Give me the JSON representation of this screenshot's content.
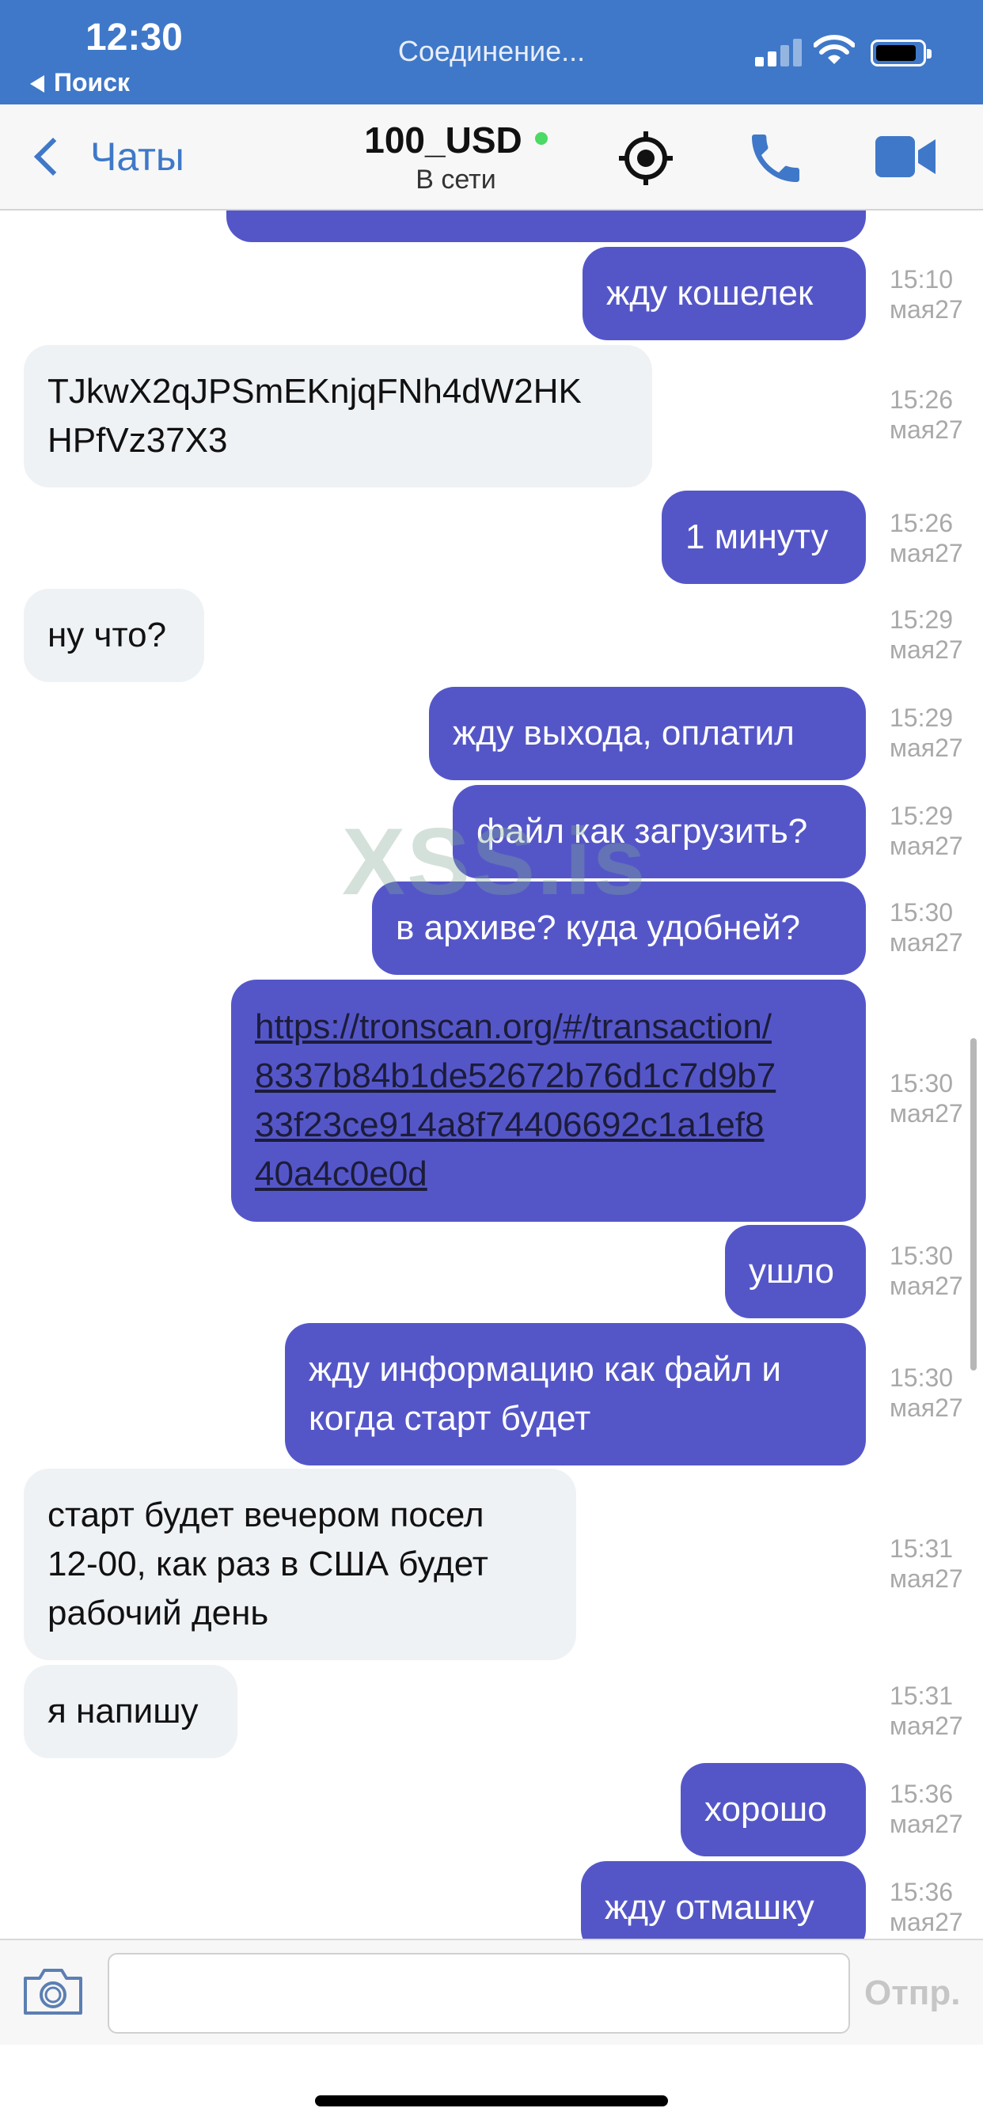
{
  "status_bar": {
    "time": "12:30",
    "back_app": "Поиск",
    "connection": "Соединение..."
  },
  "nav": {
    "back_label": "Чаты",
    "contact_name": "100_USD",
    "contact_status": "В сети",
    "online_color": "#4cd964",
    "accent_color": "#3f78c8"
  },
  "colors": {
    "outgoing_bubble": "#5456c8",
    "incoming_bubble": "#eff2f5"
  },
  "messages": [
    {
      "direction": "out",
      "text": "жду кошелек",
      "time": "15:10",
      "date": "мая27"
    },
    {
      "direction": "in",
      "lines": [
        "TJkwX2qJPSmEKnjqFNh4dW2HK",
        "HPfVz37X3"
      ],
      "time": "15:26",
      "date": "мая27"
    },
    {
      "direction": "out",
      "text": "1 минуту",
      "time": "15:26",
      "date": "мая27"
    },
    {
      "direction": "in",
      "text": "ну что?",
      "time": "15:29",
      "date": "мая27"
    },
    {
      "direction": "out",
      "text": "жду выхода, оплатил",
      "time": "15:29",
      "date": "мая27"
    },
    {
      "direction": "out",
      "text": "файл как загрузить?",
      "time": "15:29",
      "date": "мая27"
    },
    {
      "direction": "out",
      "text": "в архиве? куда удобней?",
      "time": "15:30",
      "date": "мая27"
    },
    {
      "direction": "out",
      "lines": [
        "https://tronscan.org/#/transaction/",
        "8337b84b1de52672b76d1c7d9b7",
        "33f23ce914a8f74406692c1a1ef8",
        "40a4c0e0d"
      ],
      "time": "15:30",
      "date": "мая27"
    },
    {
      "direction": "out",
      "text": "ушло",
      "time": "15:30",
      "date": "мая27"
    },
    {
      "direction": "out",
      "lines": [
        "жду информацию как файл и",
        "когда старт будет"
      ],
      "time": "15:30",
      "date": "мая27"
    },
    {
      "direction": "in",
      "lines": [
        "старт будет вечером посел",
        "12-00, как раз в США будет",
        "рабочий день"
      ],
      "time": "15:31",
      "date": "мая27"
    },
    {
      "direction": "in",
      "text": "я напишу",
      "time": "15:31",
      "date": "мая27"
    },
    {
      "direction": "out",
      "text": "хорошо",
      "time": "15:36",
      "date": "мая27"
    },
    {
      "direction": "out",
      "text": "жду отмашку",
      "time": "15:36",
      "date": "мая27"
    }
  ],
  "watermark": "XSS.is",
  "input": {
    "placeholder": "",
    "send_label": "Отпр."
  }
}
